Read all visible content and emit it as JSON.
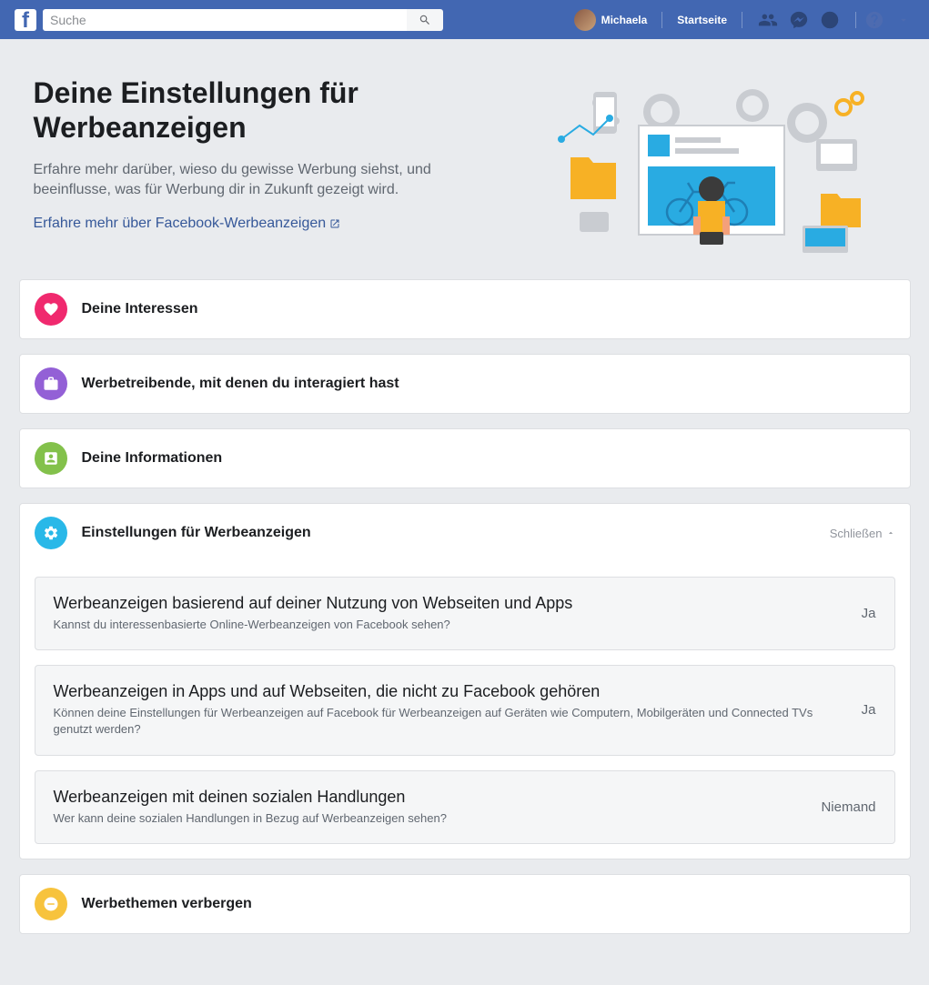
{
  "navbar": {
    "search_placeholder": "Suche",
    "user_name": "Michaela",
    "home_label": "Startseite"
  },
  "hero": {
    "title": "Deine Einstellungen für Werbeanzeigen",
    "subtitle": "Erfahre mehr darüber, wieso du gewisse Werbung siehst, und beeinflusse, was für Werbung dir in Zukunft gezeigt wird.",
    "link_text": "Erfahre mehr über Facebook-Werbeanzeigen"
  },
  "sections": {
    "interests": {
      "title": "Deine Interessen"
    },
    "advertisers": {
      "title": "Werbetreibende, mit denen du interagiert hast"
    },
    "your_info": {
      "title": "Deine Informationen"
    },
    "ad_settings": {
      "title": "Einstellungen für Werbeanzeigen",
      "close_label": "Schließen"
    },
    "hide_topics": {
      "title": "Werbethemen verbergen"
    }
  },
  "settings": [
    {
      "title": "Werbeanzeigen basierend auf deiner Nutzung von Webseiten und Apps",
      "desc": "Kannst du interessenbasierte Online-Werbeanzeigen von Facebook sehen?",
      "value": "Ja"
    },
    {
      "title": "Werbeanzeigen in Apps und auf Webseiten, die nicht zu Facebook gehören",
      "desc": "Können deine Einstellungen für Werbeanzeigen auf Facebook für Werbeanzeigen auf Geräten wie Computern, Mobilgeräten und Connected TVs genutzt werden?",
      "value": "Ja"
    },
    {
      "title": "Werbeanzeigen mit deinen sozialen Handlungen",
      "desc": "Wer kann deine sozialen Handlungen in Bezug auf Werbeanzeigen sehen?",
      "value": "Niemand"
    }
  ]
}
